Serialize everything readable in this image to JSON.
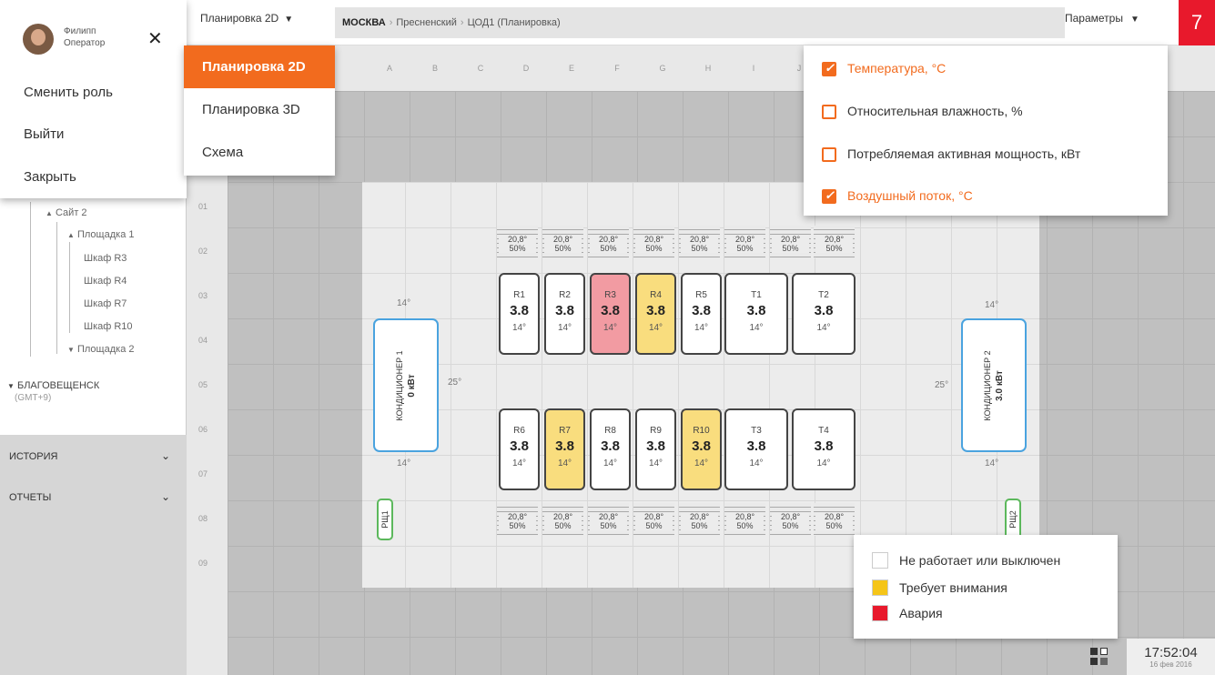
{
  "user": {
    "name": "Филипп",
    "role": "Оператор"
  },
  "user_menu": {
    "change_role": "Сменить роль",
    "logout": "Выйти",
    "close": "Закрыть"
  },
  "tree": {
    "site2": "Сайт 2",
    "area1": "Площадка 1",
    "cab_r3": "Шкаф R3",
    "cab_r4": "Шкаф R4",
    "cab_r7": "Шкаф R7",
    "cab_r10": "Шкаф R10",
    "area2": "Площадка 2",
    "city": "БЛАГОВЕЩЕНСК",
    "tz": "(GMT+9)"
  },
  "sections": {
    "history": "ИСТОРИЯ",
    "reports": "ОТЧЕТЫ"
  },
  "topbar": {
    "view": "Планировка 2D",
    "bc_city": "МОСКВА",
    "bc_district": "Пресненский",
    "bc_dc": "ЦОД1 (Планировка)",
    "params": "Параметры",
    "badge": "7"
  },
  "view_menu": [
    "Планировка 2D",
    "Планировка 3D",
    "Схема"
  ],
  "params_menu": [
    {
      "label": "Температура, °C",
      "checked": true
    },
    {
      "label": "Относительная влажность, %",
      "checked": false
    },
    {
      "label": "Потребляемая активная мощность, кВт",
      "checked": false
    },
    {
      "label": "Воздушный поток, °C",
      "checked": true
    }
  ],
  "columns": [
    "A",
    "B",
    "C",
    "D",
    "E",
    "F",
    "G",
    "H",
    "I",
    "J"
  ],
  "rows": [
    "01",
    "02",
    "03",
    "04",
    "05",
    "06",
    "07",
    "08",
    "09"
  ],
  "env": {
    "temp": "20,8°",
    "hum": "50%"
  },
  "racks_top": [
    {
      "name": "R1",
      "value": "3.8",
      "temp": "14°",
      "state": "normal"
    },
    {
      "name": "R2",
      "value": "3.8",
      "temp": "14°",
      "state": "normal"
    },
    {
      "name": "R3",
      "value": "3.8",
      "temp": "14°",
      "state": "alarm"
    },
    {
      "name": "R4",
      "value": "3.8",
      "temp": "14°",
      "state": "warn"
    },
    {
      "name": "R5",
      "value": "3.8",
      "temp": "14°",
      "state": "normal"
    },
    {
      "name": "T1",
      "value": "3.8",
      "temp": "14°",
      "state": "normal"
    },
    {
      "name": "T2",
      "value": "3.8",
      "temp": "14°",
      "state": "normal"
    }
  ],
  "racks_bottom": [
    {
      "name": "R6",
      "value": "3.8",
      "temp": "14°",
      "state": "normal"
    },
    {
      "name": "R7",
      "value": "3.8",
      "temp": "14°",
      "state": "warn"
    },
    {
      "name": "R8",
      "value": "3.8",
      "temp": "14°",
      "state": "normal"
    },
    {
      "name": "R9",
      "value": "3.8",
      "temp": "14°",
      "state": "normal"
    },
    {
      "name": "R10",
      "value": "3.8",
      "temp": "14°",
      "state": "warn"
    },
    {
      "name": "T3",
      "value": "3.8",
      "temp": "14°",
      "state": "normal"
    },
    {
      "name": "T4",
      "value": "3.8",
      "temp": "14°",
      "state": "normal"
    }
  ],
  "ac1": {
    "name": "КОНДИЦИОНЕР 1",
    "power": "0 кВт",
    "t_top": "14°",
    "t_side": "25°",
    "t_bottom": "14°"
  },
  "ac2": {
    "name": "КОНДИЦИОНЕР 2",
    "power": "3.0 кВт",
    "t_top": "14°",
    "t_side": "25°",
    "t_bottom": "14°"
  },
  "pdu1": "РЩ1",
  "pdu2": "РЩ2",
  "legend": {
    "off": "Не работает или выключен",
    "attention": "Требует внимания",
    "alarm": "Авария"
  },
  "colors": {
    "accent": "#f26b1e",
    "warn": "#f9dd7e",
    "alarm": "#f29ba2",
    "legend_alarm": "#e8192c",
    "legend_warn": "#f5c518",
    "ac_border": "#4aa3df",
    "pdu_border": "#5cb85c"
  },
  "clock": {
    "time": "17:52:04",
    "date": "16 фев 2016"
  }
}
